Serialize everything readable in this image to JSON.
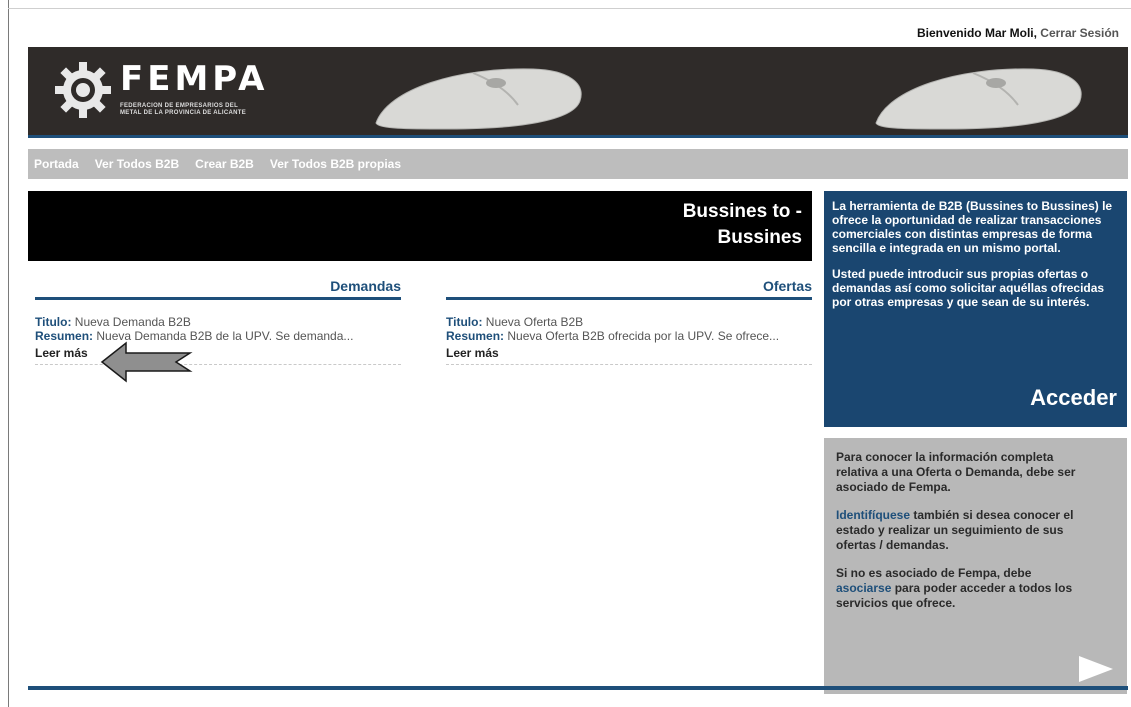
{
  "header": {
    "welcome_text": "Bienvenido Mar Moli,",
    "logout_label": "Cerrar Sesión"
  },
  "banner": {
    "logo_title": "FEMPA",
    "logo_subtitle_line1": "FEDERACION DE EMPRESARIOS DEL",
    "logo_subtitle_line2": "METAL DE LA PROVINCIA DE ALICANTE"
  },
  "nav": {
    "items": [
      {
        "label": "Portada"
      },
      {
        "label": "Ver Todos B2B"
      },
      {
        "label": "Crear B2B"
      },
      {
        "label": "Ver Todos B2B propias"
      }
    ]
  },
  "main": {
    "title_line1": "Bussines to -",
    "title_line2": "Bussines",
    "demandas": {
      "heading": "Demandas",
      "title_label": "Titulo:",
      "title_value": "Nueva Demanda B2B",
      "summary_label": "Resumen:",
      "summary_value": "Nueva Demanda B2B de la UPV. Se demanda...",
      "read_more": "Leer más"
    },
    "ofertas": {
      "heading": "Ofertas",
      "title_label": "Titulo:",
      "title_value": "Nueva Oferta B2B",
      "summary_label": "Resumen:",
      "summary_value": "Nueva Oferta B2B ofrecida por la UPV. Se ofrece...",
      "read_more": "Leer más"
    }
  },
  "sidebar": {
    "intro_p1": "La herramienta de B2B (Bussines to Bussines) le ofrece la oportunidad de realizar transacciones comerciales con distintas empresas de forma sencilla e integrada en un mismo portal.",
    "intro_p2": "Usted puede introducir sus propias ofertas o demandas así como solicitar aquéllas ofrecidas por otras empresas y que sean de su interés.",
    "access_label": "Acceder",
    "info_p1": "Para conocer la información completa relativa a una Oferta o Demanda, debe ser asociado de Fempa.",
    "identify_link": "Identifíquese",
    "info_p2_rest": " también si desea conocer el estado y realizar un seguimiento de sus ofertas / demandas.",
    "info_p3_start": "Si no es asociado de Fempa, debe ",
    "associate_link": "asociarse",
    "info_p3_end": " para poder acceder a todos los servicios que ofrece."
  },
  "colors": {
    "brand_blue": "#1e4f7a",
    "sidebar_blue": "#1a4670",
    "nav_grey": "#bdbdbd",
    "banner_dark": "#2f2b29"
  },
  "icons": {
    "logo": "gear-logo-icon",
    "banner_image": "computer-mouse-icon",
    "next": "play-arrow-icon",
    "pointer": "left-arrow-annotation-icon"
  }
}
